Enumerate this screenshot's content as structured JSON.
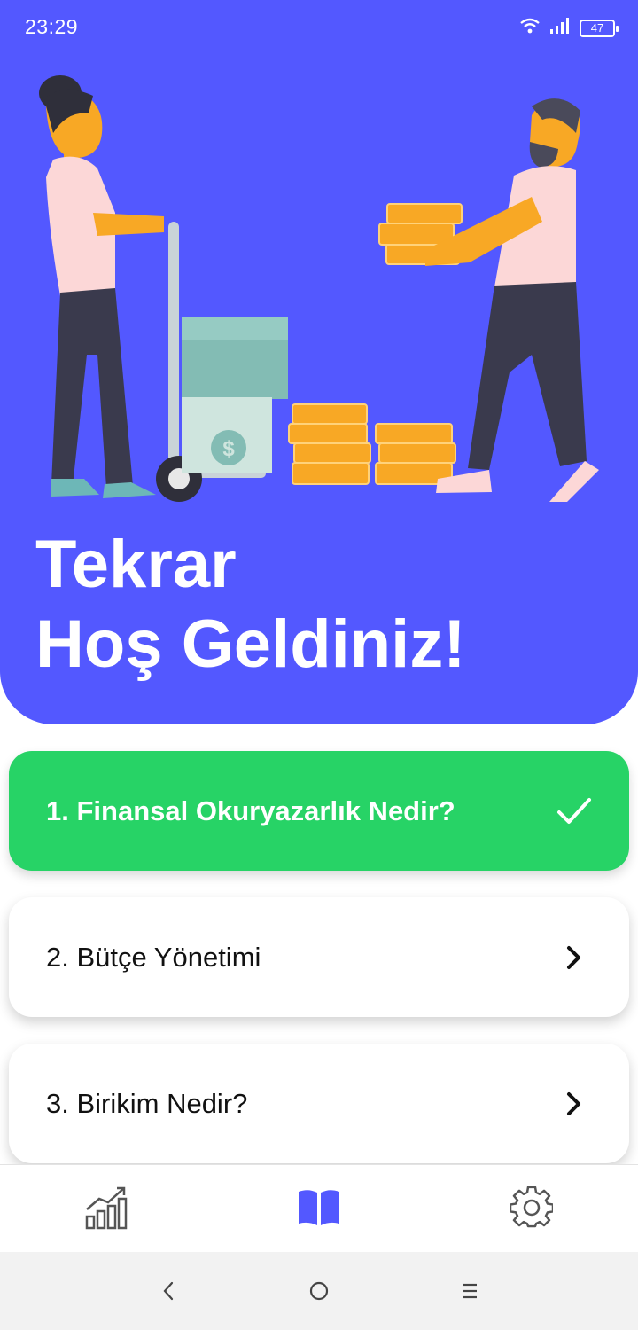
{
  "status_bar": {
    "time": "23:29",
    "battery_level": "47",
    "icons": [
      "wifi-icon",
      "signal-icon",
      "battery-icon"
    ]
  },
  "hero": {
    "background_color": "#5358ff",
    "title_line1": "Tekrar",
    "title_line2": "Hoş Geldiniz!"
  },
  "lessons": [
    {
      "label": "1. Finansal Okuryazarlık Nedir?",
      "status": "completed",
      "icon": "check-icon",
      "color": "#27d366"
    },
    {
      "label": "2. Bütçe Yönetimi",
      "status": "open",
      "icon": "chevron-right-icon"
    },
    {
      "label": "3. Birikim Nedir?",
      "status": "open",
      "icon": "chevron-right-icon"
    }
  ],
  "bottom_nav": {
    "items": [
      {
        "icon": "chart-icon",
        "active": false
      },
      {
        "icon": "book-icon",
        "active": true
      },
      {
        "icon": "gear-icon",
        "active": false
      }
    ],
    "active_color": "#5358ff",
    "inactive_color": "#555555"
  },
  "system_nav": [
    "back-icon",
    "home-icon",
    "menu-icon"
  ]
}
